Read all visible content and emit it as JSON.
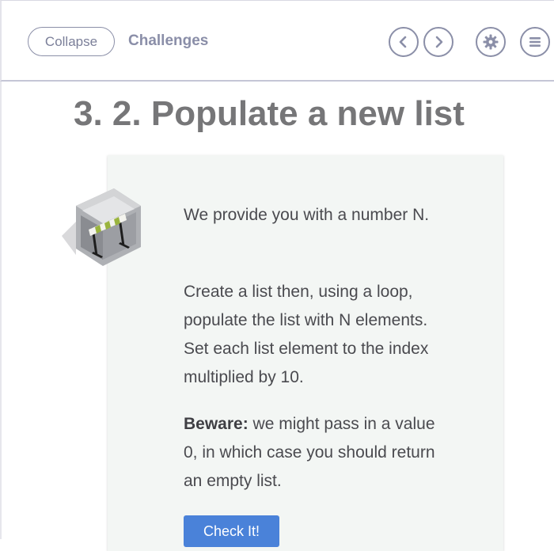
{
  "header": {
    "collapse_label": "Collapse",
    "section_label": "Challenges",
    "icons": [
      "chevron-left-icon",
      "chevron-right-icon",
      "gear-icon",
      "menu-icon"
    ]
  },
  "challenge": {
    "title": "3. 2. Populate a new list",
    "paragraph_1": "We provide you with a number N.",
    "paragraph_2": "Create a list then, using a loop, populate the list with N elements. Set each list element to the index multiplied by 10.",
    "paragraph_3_strong": "Beware:",
    "paragraph_3_rest": " we might pass in a value 0, in which case you should return an empty list.",
    "check_button_label": "Check It!"
  },
  "colors": {
    "accent": "#4a82d9",
    "card_background": "#f3f6f4",
    "icon_outline": "#8b8fa8"
  }
}
